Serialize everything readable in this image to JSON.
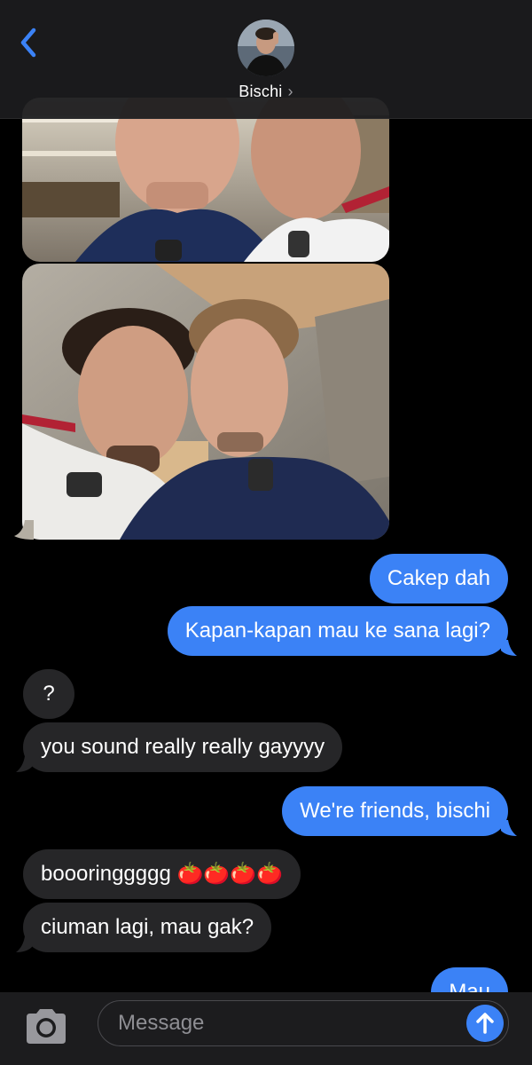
{
  "header": {
    "contact_name": "Bischi",
    "chevron": "›"
  },
  "messages": [
    {
      "from": "me",
      "text": "Cakep dah"
    },
    {
      "from": "me",
      "text": "Kapan-kapan mau ke sana lagi?"
    },
    {
      "from": "them",
      "text": "?"
    },
    {
      "from": "them",
      "text": "you sound really really gayyyy"
    },
    {
      "from": "me",
      "text": "We're friends, bischi"
    },
    {
      "from": "them",
      "text": "boooringgggg 🍅🍅🍅🍅"
    },
    {
      "from": "them",
      "text": "ciuman lagi, mau gak?"
    },
    {
      "from": "me",
      "text": "Mau"
    }
  ],
  "composer": {
    "placeholder": "Message"
  },
  "icons": {
    "back": "chevron-left-icon",
    "camera": "camera-icon",
    "send": "arrow-up-icon"
  },
  "colors": {
    "outgoing": "#3b82f6",
    "incoming": "#262628",
    "accent": "#3b82f6"
  }
}
